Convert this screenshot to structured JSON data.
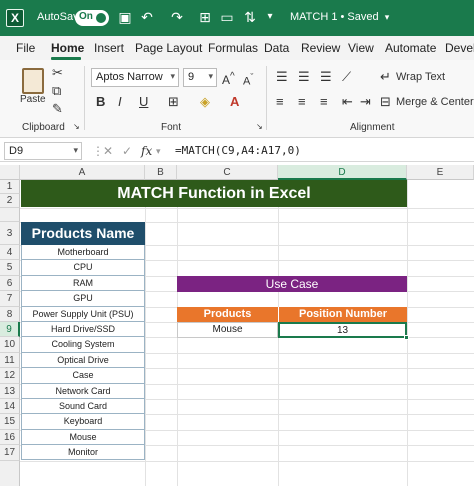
{
  "titlebar": {
    "autosave_label": "AutoSave",
    "autosave_state": "On",
    "document_title": "MATCH 1 • Saved",
    "icons": [
      "save-icon",
      "undo-icon",
      "redo-icon",
      "table-icon",
      "image-icon",
      "sort-icon"
    ]
  },
  "tabs": [
    "File",
    "Home",
    "Insert",
    "Page Layout",
    "Formulas",
    "Data",
    "Review",
    "View",
    "Automate",
    "Devel"
  ],
  "ribbon": {
    "paste_label": "Paste",
    "clipboard_label": "Clipboard",
    "font_name": "Aptos Narrow",
    "font_size": "9",
    "font_label": "Font",
    "wrap_text": "Wrap Text",
    "merge_center": "Merge & Center",
    "alignment_label": "Alignment"
  },
  "formula_bar": {
    "name_box": "D9",
    "fx": "fx",
    "formula": "=MATCH(C9,A4:A17,0)"
  },
  "grid": {
    "columns": [
      "A",
      "B",
      "C",
      "D",
      "E"
    ],
    "rows": [
      "1",
      "2",
      "3",
      "4",
      "5",
      "6",
      "7",
      "8",
      "9",
      "10",
      "11",
      "12",
      "13",
      "14",
      "15",
      "16",
      "17"
    ],
    "selected_column": "D",
    "selected_row": "9"
  },
  "sheet": {
    "title": "MATCH Function in Excel",
    "products_header": "Products Name",
    "products": [
      "Motherboard",
      "CPU",
      "RAM",
      "GPU",
      "Power Supply Unit (PSU)",
      "Hard Drive/SSD",
      "Cooling System",
      "Optical Drive",
      "Case",
      "Network Card",
      "Sound Card",
      "Keyboard",
      "Mouse",
      "Monitor"
    ],
    "use_case_label": "Use Case",
    "lookup_headers": [
      "Products",
      "Position Number"
    ],
    "lookup_product": "Mouse",
    "lookup_result": "13"
  },
  "colors": {
    "excel_green": "#1a7a4c",
    "title_fill": "#2e5a1a",
    "header_fill": "#1f4e6b",
    "use_case_fill": "#7b2382",
    "orange_header": "#e9762b"
  }
}
